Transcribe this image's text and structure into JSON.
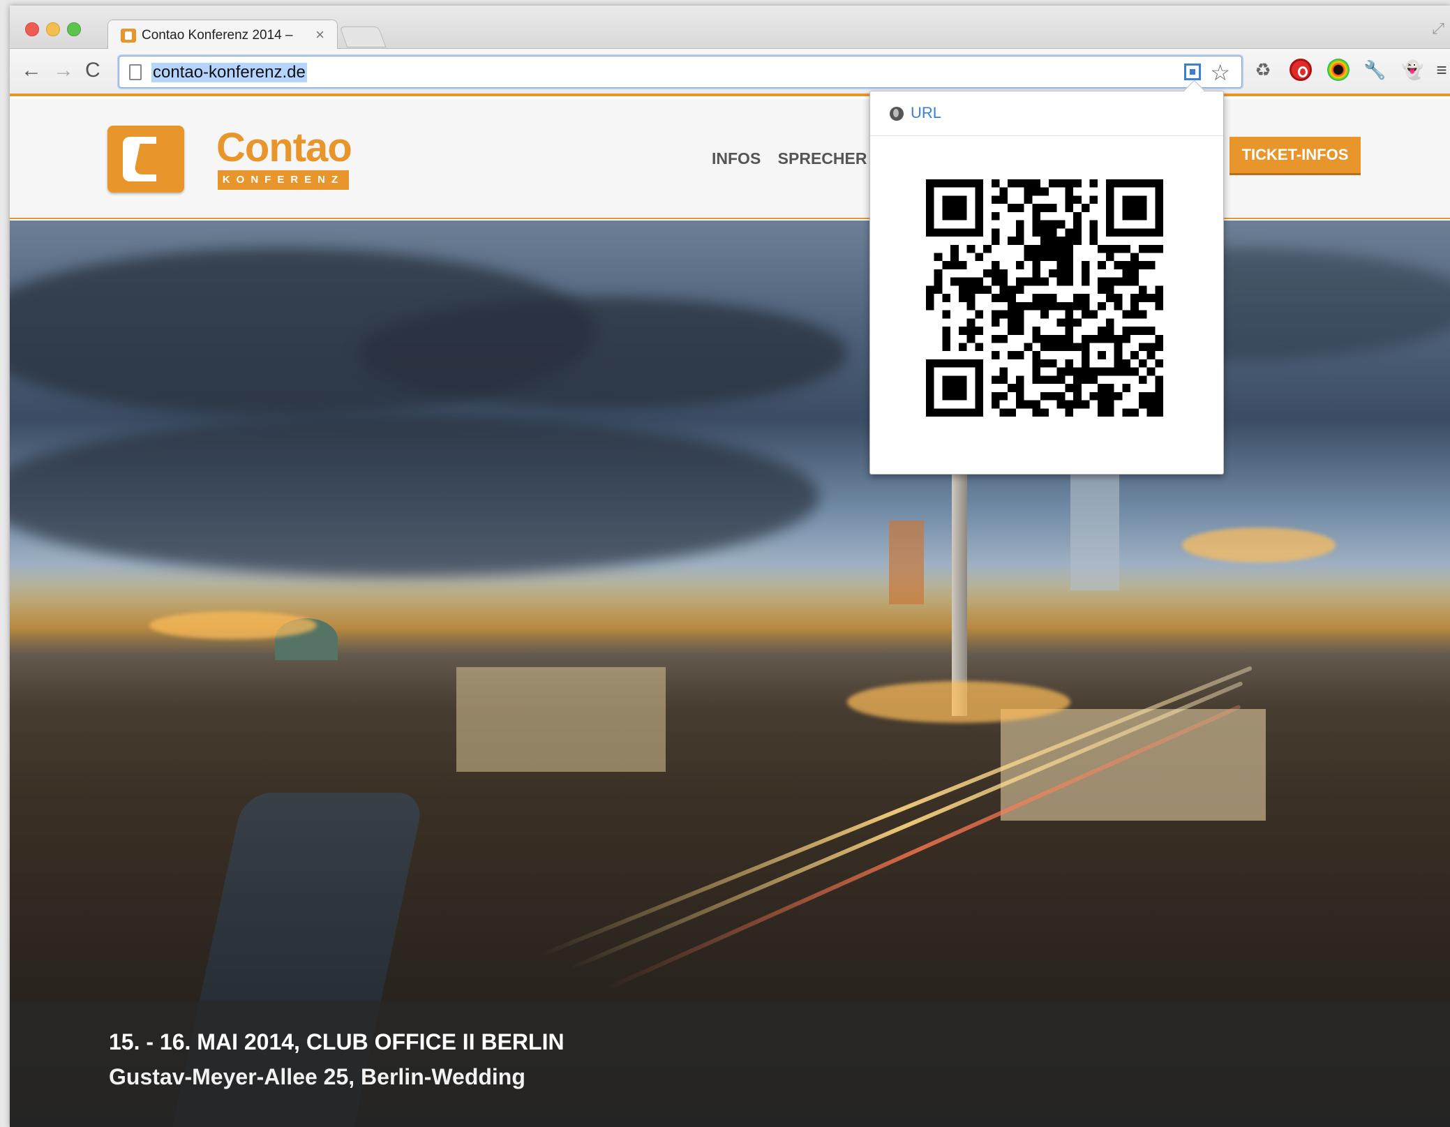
{
  "browser": {
    "tab_title": "Contao Konferenz 2014 –",
    "tab_close": "×",
    "url": "contao-konferenz.de",
    "back": "←",
    "forward": "→",
    "reload": "C",
    "star": "☆",
    "menu": "≡",
    "extensions": [
      "recycle-icon",
      "stop-icon",
      "color-picker-icon",
      "wrench-icon",
      "ghost-icon"
    ]
  },
  "site": {
    "logo_title": "Contao",
    "logo_subtitle": "KONFERENZ",
    "nav": [
      "INFOS",
      "SPRECHER"
    ],
    "cta": "TICKET-INFOS",
    "accent_color": "#e8962b"
  },
  "hero": {
    "line1": "15. - 16. MAI 2014, CLUB OFFICE II BERLIN",
    "line2": "Gustav-Meyer-Allee 25, Berlin-Wedding"
  },
  "popup": {
    "label": "URL"
  }
}
